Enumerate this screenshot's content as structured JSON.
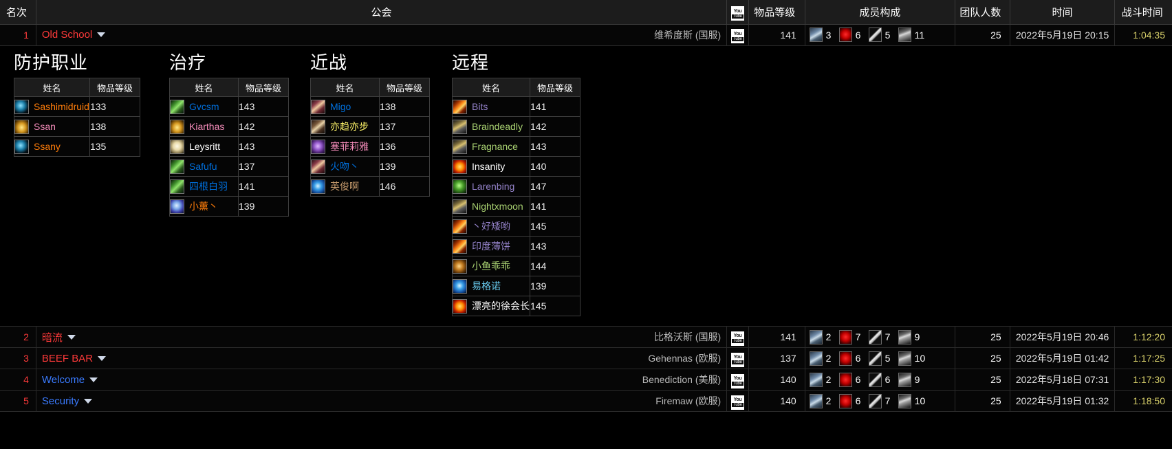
{
  "header": {
    "columns": [
      {
        "key": "rank",
        "label": "名次"
      },
      {
        "key": "guild",
        "label": "公会"
      },
      {
        "key": "yt",
        "label": "youtube-icon"
      },
      {
        "key": "ilvl",
        "label": "物品等级"
      },
      {
        "key": "comp",
        "label": "成员构成"
      },
      {
        "key": "size",
        "label": "团队人数"
      },
      {
        "key": "date",
        "label": "时间"
      },
      {
        "key": "fight",
        "label": "战斗时间"
      }
    ]
  },
  "colors": {
    "rank_number": "#ff3a3a",
    "guild_red": "#ff3a3a",
    "guild_blue": "#3a7bff",
    "fight_time": "#d8d06a",
    "header_bg": "#1c1c1c",
    "row_bg": "#060606"
  },
  "rows": [
    {
      "rank": "1",
      "guild": "Old School",
      "guild_color": "red",
      "server": "维希度斯 (国服)",
      "youtube": "youtube-icon",
      "ilvl": "141",
      "comp": [
        {
          "role": "tank",
          "count": "3"
        },
        {
          "role": "heal",
          "count": "6"
        },
        {
          "role": "melee",
          "count": "5"
        },
        {
          "role": "ranged",
          "count": "11"
        }
      ],
      "size": "25",
      "date": "2022年5月19日 20:15",
      "fight": "1:04:35",
      "expanded": true
    },
    {
      "rank": "2",
      "guild": "暗流",
      "guild_color": "red",
      "server": "比格沃斯 (国服)",
      "youtube": "youtube-icon",
      "ilvl": "141",
      "comp": [
        {
          "role": "tank",
          "count": "2"
        },
        {
          "role": "heal",
          "count": "7"
        },
        {
          "role": "melee",
          "count": "7"
        },
        {
          "role": "ranged",
          "count": "9"
        }
      ],
      "size": "25",
      "date": "2022年5月19日 20:46",
      "fight": "1:12:20",
      "expanded": false
    },
    {
      "rank": "3",
      "guild": "BEEF BAR",
      "guild_color": "red",
      "server": "Gehennas (欧服)",
      "youtube": "youtube-icon",
      "ilvl": "137",
      "comp": [
        {
          "role": "tank",
          "count": "2"
        },
        {
          "role": "heal",
          "count": "6"
        },
        {
          "role": "melee",
          "count": "5"
        },
        {
          "role": "ranged",
          "count": "10"
        }
      ],
      "size": "25",
      "date": "2022年5月19日 01:42",
      "fight": "1:17:25",
      "expanded": false
    },
    {
      "rank": "4",
      "guild": "Welcome",
      "guild_color": "blue",
      "server": "Benediction (美服)",
      "youtube": "youtube-icon",
      "ilvl": "140",
      "comp": [
        {
          "role": "tank",
          "count": "2"
        },
        {
          "role": "heal",
          "count": "6"
        },
        {
          "role": "melee",
          "count": "6"
        },
        {
          "role": "ranged",
          "count": "9"
        }
      ],
      "size": "25",
      "date": "2022年5月18日 07:31",
      "fight": "1:17:30",
      "expanded": false
    },
    {
      "rank": "5",
      "guild": "Security",
      "guild_color": "blue",
      "server": "Firemaw (欧服)",
      "youtube": "youtube-icon",
      "ilvl": "140",
      "comp": [
        {
          "role": "tank",
          "count": "2"
        },
        {
          "role": "heal",
          "count": "6"
        },
        {
          "role": "melee",
          "count": "7"
        },
        {
          "role": "ranged",
          "count": "10"
        }
      ],
      "size": "25",
      "date": "2022年5月19日 01:32",
      "fight": "1:18:50",
      "expanded": false
    }
  ],
  "roster": {
    "col_name": "姓名",
    "col_ilvl": "物品等级",
    "groups": [
      {
        "title": "防护职业",
        "players": [
          {
            "name": "Sashimidruid",
            "ilvl": "133",
            "cls": "druid",
            "icon": "ic-druid"
          },
          {
            "name": "Ssan",
            "ilvl": "138",
            "cls": "paladin",
            "icon": "ic-paladin"
          },
          {
            "name": "Ssany",
            "ilvl": "135",
            "cls": "druid",
            "icon": "ic-druid"
          }
        ]
      },
      {
        "title": "治疗",
        "players": [
          {
            "name": "Gvcsm",
            "ilvl": "143",
            "cls": "shaman",
            "icon": "ic-shaman"
          },
          {
            "name": "Kiarthas",
            "ilvl": "142",
            "cls": "paladin",
            "icon": "ic-paladin"
          },
          {
            "name": "Leysritt",
            "ilvl": "143",
            "cls": "priest",
            "icon": "ic-priest"
          },
          {
            "name": "Safufu",
            "ilvl": "137",
            "cls": "shaman",
            "icon": "ic-shaman"
          },
          {
            "name": "四根白羽",
            "ilvl": "141",
            "cls": "shaman",
            "icon": "ic-shaman"
          },
          {
            "name": "小薰丶",
            "ilvl": "139",
            "cls": "druid",
            "icon": "ic-mage"
          }
        ]
      },
      {
        "title": "近战",
        "players": [
          {
            "name": "Migo",
            "ilvl": "138",
            "cls": "shaman",
            "icon": "ic-rogue"
          },
          {
            "name": "亦趋亦步",
            "ilvl": "137",
            "cls": "rogue",
            "icon": "ic-warrior"
          },
          {
            "name": "塞菲莉雅",
            "ilvl": "136",
            "cls": "paladin",
            "icon": "ic-demon"
          },
          {
            "name": "火吻丶",
            "ilvl": "139",
            "cls": "shaman",
            "icon": "ic-rogue"
          },
          {
            "name": "英俊啊",
            "ilvl": "146",
            "cls": "warrior",
            "icon": "ic-frost"
          }
        ]
      },
      {
        "title": "远程",
        "players": [
          {
            "name": "Bits",
            "ilvl": "141",
            "cls": "warlock",
            "icon": "ic-fire"
          },
          {
            "name": "Braindeadly",
            "ilvl": "142",
            "cls": "hunter",
            "icon": "ic-hunter"
          },
          {
            "name": "Fragnance",
            "ilvl": "143",
            "cls": "hunter",
            "icon": "ic-hunter"
          },
          {
            "name": "Insanity",
            "ilvl": "140",
            "cls": "priest",
            "icon": "ic-sun"
          },
          {
            "name": "Larenbing",
            "ilvl": "147",
            "cls": "warlock",
            "icon": "ic-nature"
          },
          {
            "name": "Nightxmoon",
            "ilvl": "141",
            "cls": "hunter",
            "icon": "ic-hunter"
          },
          {
            "name": "丶好矮哟",
            "ilvl": "145",
            "cls": "warlock",
            "icon": "ic-fire"
          },
          {
            "name": "印度薄饼",
            "ilvl": "143",
            "cls": "warlock",
            "icon": "ic-fire"
          },
          {
            "name": "小鱼乖乖",
            "ilvl": "144",
            "cls": "hunter",
            "icon": "ic-beast"
          },
          {
            "name": "易格诺",
            "ilvl": "139",
            "cls": "mage",
            "icon": "ic-frost"
          },
          {
            "name": "漂亮的徐会长",
            "ilvl": "145",
            "cls": "priest",
            "icon": "ic-sun"
          }
        ]
      }
    ]
  }
}
